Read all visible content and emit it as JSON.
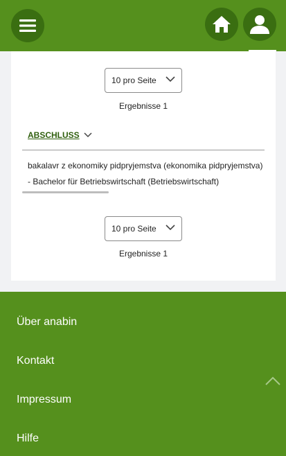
{
  "header": {
    "menu_icon": "hamburger-menu-icon",
    "home_icon": "home-icon",
    "user_icon": "user-icon"
  },
  "pagination_top": {
    "select_value": "10 pro Seite",
    "results": "Ergebnisse 1"
  },
  "table": {
    "column_header": "ABSCHLUSS",
    "row_lines": [
      "bakalavr z ekonomiky pidpryjemstva (ekonomika pidpryjemstva)",
      "- Bachelor für Betriebswirtschaft (Betriebswirtschaft)"
    ]
  },
  "pagination_bottom": {
    "select_value": "10 pro Seite",
    "results": "Ergebnisse 1"
  },
  "footer": {
    "links": [
      "Über anabin",
      "Kontakt",
      "Impressum",
      "Hilfe"
    ],
    "scroll_top_icon": "chevron-up-icon"
  },
  "colors": {
    "brand_green": "#55901d",
    "dark_green": "#3a6e11",
    "link_green": "#2f5f0d"
  }
}
